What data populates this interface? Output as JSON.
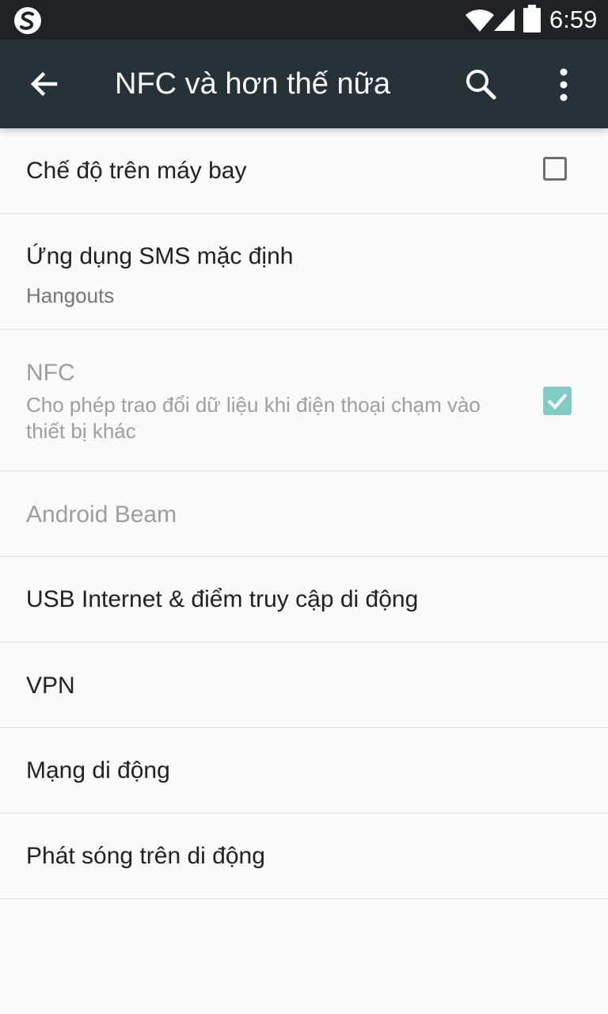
{
  "status_bar": {
    "time": "6:59",
    "icons": [
      "app-s-icon",
      "wifi-icon",
      "signal-icon",
      "battery-icon"
    ]
  },
  "toolbar": {
    "title": "NFC và hơn thế nữa",
    "icons": [
      "back-arrow-icon",
      "search-icon",
      "more-vert-icon"
    ]
  },
  "settings": [
    {
      "title": "Chế độ trên máy bay",
      "checkbox": true,
      "checked": false,
      "enabled": true
    },
    {
      "title": "Ứng dụng SMS mặc định",
      "summary": "Hangouts",
      "enabled": true
    },
    {
      "title": "NFC",
      "summary": "Cho phép trao đổi dữ liệu khi điện thoại chạm vào thiết bị khác",
      "checkbox": true,
      "checked": true,
      "enabled": false
    },
    {
      "title": "Android Beam",
      "enabled": false
    },
    {
      "title": "USB Internet & điểm truy cập di động",
      "enabled": true
    },
    {
      "title": "VPN",
      "enabled": true
    },
    {
      "title": "Mạng di động",
      "enabled": true
    },
    {
      "title": "Phát sóng trên di động",
      "enabled": true
    }
  ],
  "colors": {
    "status_bar": "#1f2326",
    "toolbar": "#263238",
    "background": "#fafafa",
    "accent_checked": "#80cbc4"
  }
}
